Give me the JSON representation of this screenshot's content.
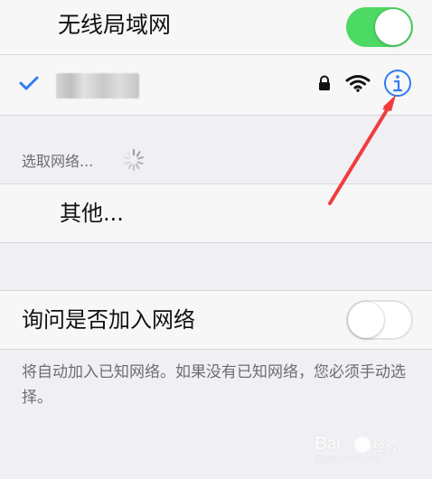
{
  "settings": {
    "wifi_toggle": {
      "label": "无线局域网",
      "state": "on",
      "color": "#4cd964"
    },
    "connected_network": {
      "checked": true,
      "icons": [
        "checkmark-icon",
        "lock-icon",
        "wifi-signal-icon",
        "info-icon"
      ]
    },
    "section": {
      "label": "选取网络..."
    },
    "other_row": {
      "label": "其他..."
    },
    "ask_to_join": {
      "label": "询问是否加入网络",
      "state": "off"
    },
    "footer_note": "将自动加入已知网络。如果没有已知网络，您必须手动选择。"
  },
  "watermark": {
    "brand": "Bai",
    "service": "经验",
    "domain": "jingyan.baidu.com"
  },
  "annotation": {
    "arrow_color": "#f03c3c",
    "target": "info-icon"
  }
}
